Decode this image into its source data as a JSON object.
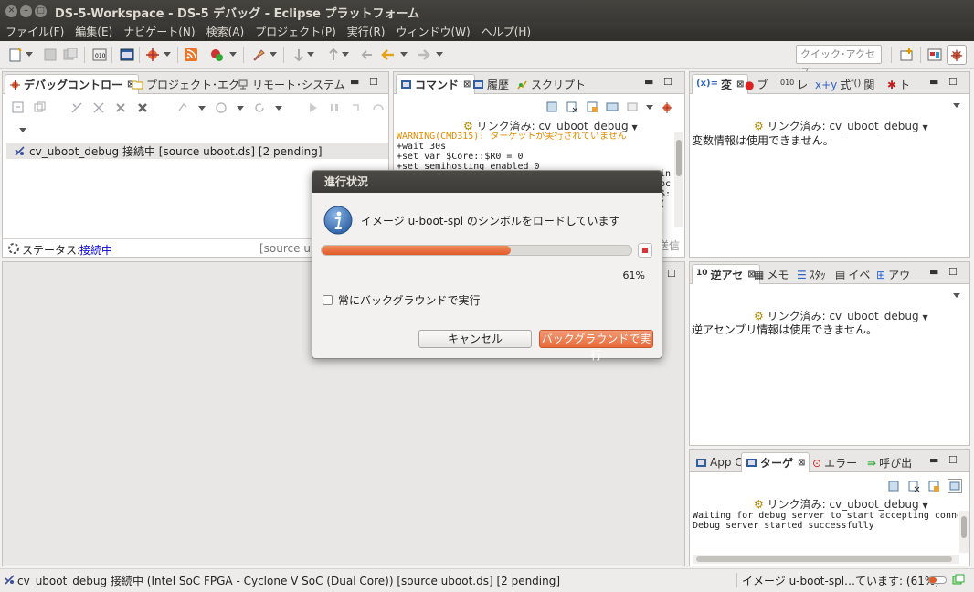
{
  "window": {
    "title": "DS-5-Workspace - DS-5 デバッグ - Eclipse プラットフォーム"
  },
  "menu": [
    "ファイル(F)",
    "編集(E)",
    "ナビゲート(N)",
    "検索(A)",
    "プロジェクト(P)",
    "実行(R)",
    "ウィンドウ(W)",
    "ヘルプ(H)"
  ],
  "toolbar": {
    "quick_access_placeholder": "クイック･アクセス"
  },
  "debug_view": {
    "tabs": [
      "デバッグコントロー",
      "プロジェクト･エク",
      "リモート･システム"
    ],
    "item": "cv_uboot_debug 接続中 [source uboot.ds] [2 pending]",
    "status_label": "ステータス:",
    "status_value": "接続中",
    "status_extra": "[source ubo"
  },
  "command_view": {
    "tabs": [
      "コマンド",
      "履歴",
      "スクリプト"
    ],
    "linked": "リンク済み: cv_uboot_debug",
    "lines": [
      "WARNING(CMD315): ターゲットが実行されていません",
      "+wait 30s",
      "+set var $Core::$R0 = 0",
      "+set semihosting enabled 0"
    ],
    "right_fragments": [
      "in",
      "oc",
      "$:("
    ],
    "send_label": "送信"
  },
  "variables_view": {
    "tabs": [
      "変",
      "ブ",
      "レ",
      "式",
      "関",
      "ト"
    ],
    "linked": "リンク済み: cv_uboot_debug",
    "message": "変数情報は使用できません。"
  },
  "disassembly_view": {
    "tabs": [
      "逆アセ",
      "メモ",
      "ｽﾀｯ",
      "イベ",
      "アウ"
    ],
    "linked": "リンク済み: cv_uboot_debug",
    "message": "逆アセンブリ情報は使用できません。"
  },
  "target_view": {
    "tabs": [
      "App C",
      "ターゲ",
      "エラー",
      "呼び出"
    ],
    "linked": "リンク済み: cv_uboot_debug",
    "lines": [
      "Waiting for debug server to start accepting connecti",
      "Debug server started successfully"
    ]
  },
  "dialog": {
    "title": "進行状況",
    "message": "イメージ u-boot-spl のシンボルをロードしています",
    "progress": 0.61,
    "progress_text": "61%",
    "checkbox_label": "常にバックグラウンドで実行",
    "cancel_label": "キャンセル",
    "background_label": "バックグラウンドで実行"
  },
  "status_bar": {
    "left": "cv_uboot_debug 接続中 (Intel SoC FPGA - Cyclone V SoC (Dual Core)) [source uboot.ds] [2 pending]",
    "right": "イメージ u-boot-spl…ています: (61%)"
  },
  "colors": {
    "accent": "#e9693a",
    "progress": "#e36a36",
    "link_blue": "#0000d0",
    "warning": "#e38c00"
  }
}
